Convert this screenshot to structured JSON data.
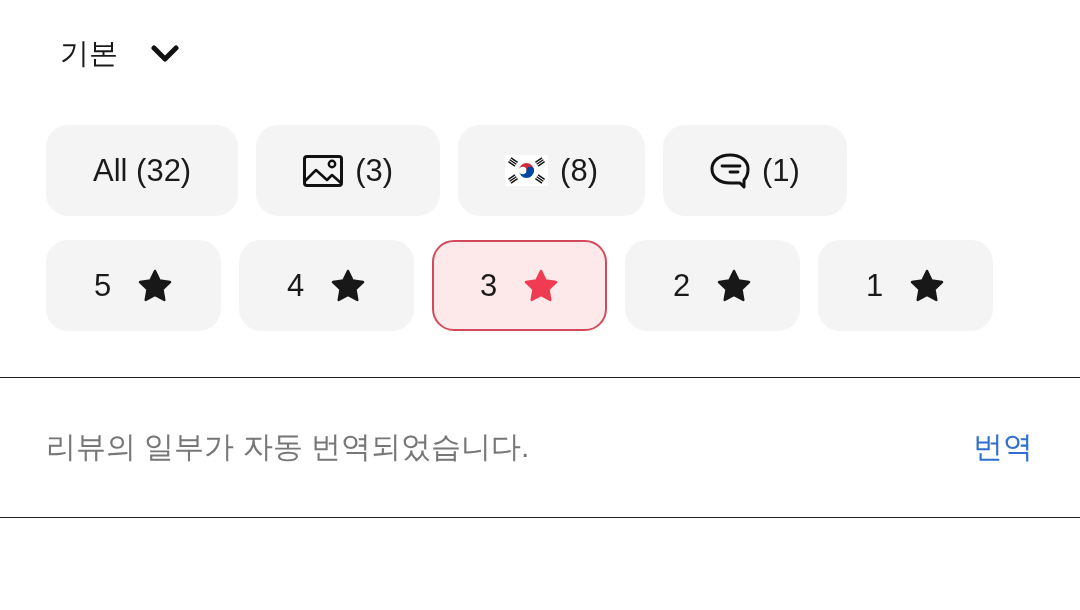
{
  "sort": {
    "label": "기본"
  },
  "filters": [
    {
      "kind": "text",
      "label": "All (32)",
      "selected": false
    },
    {
      "kind": "photo",
      "label": "(3)",
      "selected": false
    },
    {
      "kind": "flag",
      "label": "(8)",
      "selected": false
    },
    {
      "kind": "comment",
      "label": "(1)",
      "selected": false
    }
  ],
  "ratings": [
    {
      "label": "5",
      "selected": false
    },
    {
      "label": "4",
      "selected": false
    },
    {
      "label": "3",
      "selected": true
    },
    {
      "label": "2",
      "selected": false
    },
    {
      "label": "1",
      "selected": false
    }
  ],
  "translation_notice": {
    "text": "리뷰의 일부가 자동 번역되었습니다.",
    "link": "번역"
  }
}
